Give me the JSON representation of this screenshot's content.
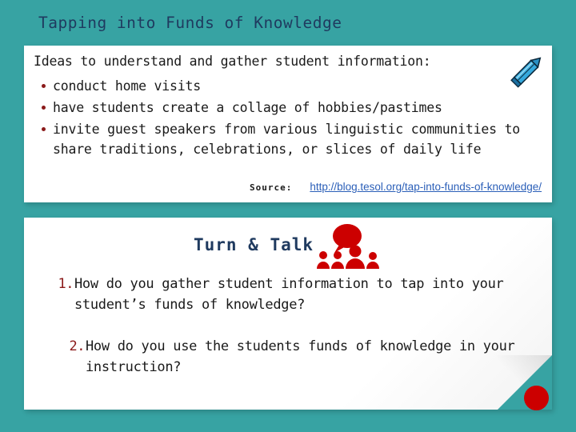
{
  "slide": {
    "background_color": "#37a3a3",
    "title": "Tapping into Funds of Knowledge"
  },
  "ideas_card": {
    "lead_text": "Ideas to understand and gather student information:",
    "bullet_marker": "•",
    "bullets": [
      "conduct home visits",
      "have students create a collage of hobbies/pastimes",
      "invite guest speakers from various linguistic communities to share traditions, celebrations, or slices of daily life"
    ],
    "pencil_icon_name": "pencil-icon",
    "pencil_color": "#2e9fd4"
  },
  "source": {
    "label": "Source:",
    "url_text": "http://blog.tesol.org/tap-into-funds-of-knowledge/",
    "link_color": "#2b5fb8"
  },
  "turn_talk_card": {
    "heading": "Turn & Talk",
    "heading_color": "#1f3a5f",
    "people_icon_name": "speech-bubble-people-icon",
    "people_icon_color": "#cc0000",
    "questions": [
      {
        "number": "1.",
        "text": "How do you gather student information to tap into your student’s funds of knowledge?"
      },
      {
        "number": "2.",
        "text": "How do you use the students funds of knowledge in your instruction?"
      }
    ]
  },
  "decorations": {
    "red_dot_name": "red-dot-decoration",
    "red_dot_color": "#cc0000",
    "folded_corner_name": "folded-corner-decoration"
  }
}
